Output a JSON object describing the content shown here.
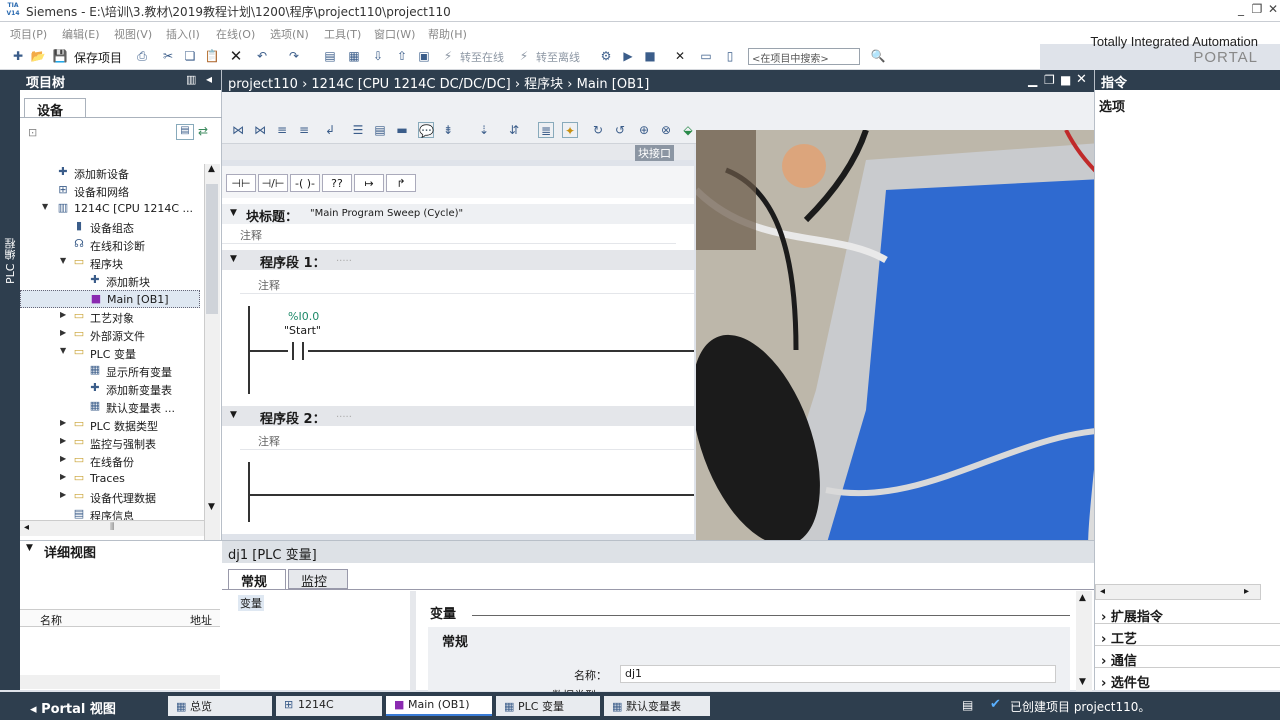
{
  "window": {
    "title": "Siemens  -  E:\\培训\\3.教材\\2019教程计划\\1200\\程序\\project110\\project110",
    "logo": "TIA V14",
    "controls": {
      "minimize": "_",
      "restore": "❐",
      "close": "✕"
    }
  },
  "menu": [
    "项目(P)",
    "编辑(E)",
    "视图(V)",
    "插入(I)",
    "在线(O)",
    "选项(N)",
    "工具(T)",
    "窗口(W)",
    "帮助(H)"
  ],
  "toolbar": {
    "save_label": "保存项目",
    "go_online": "转至在线",
    "go_offline": "转至离线",
    "search_placeholder": "<在项目中搜索>"
  },
  "brand": {
    "line1": "Totally Integrated Automation",
    "line2": "PORTAL"
  },
  "side_tab": {
    "label": "PLC 编程"
  },
  "project_tree": {
    "title": "项目树",
    "tab": "设备",
    "items": [
      {
        "label": "添加新设备",
        "indent": 0
      },
      {
        "label": "设备和网络",
        "indent": 0
      },
      {
        "label": "1214C [CPU 1214C ...",
        "indent": 0
      },
      {
        "label": "设备组态",
        "indent": 1
      },
      {
        "label": "在线和诊断",
        "indent": 1
      },
      {
        "label": "程序块",
        "indent": 1
      },
      {
        "label": "添加新块",
        "indent": 2
      },
      {
        "label": "Main [OB1]",
        "indent": 2
      },
      {
        "label": "工艺对象",
        "indent": 1
      },
      {
        "label": "外部源文件",
        "indent": 1
      },
      {
        "label": "PLC 变量",
        "indent": 1
      },
      {
        "label": "显示所有变量",
        "indent": 2
      },
      {
        "label": "添加新变量表",
        "indent": 2
      },
      {
        "label": "默认变量表 ...",
        "indent": 2
      },
      {
        "label": "PLC 数据类型",
        "indent": 1
      },
      {
        "label": "监控与强制表",
        "indent": 1
      },
      {
        "label": "在线备份",
        "indent": 1
      },
      {
        "label": "Traces",
        "indent": 1
      },
      {
        "label": "设备代理数据",
        "indent": 1
      },
      {
        "label": "程序信息",
        "indent": 1
      }
    ]
  },
  "detail_view": {
    "title": "详细视图",
    "col_name": "名称",
    "col_address": "地址"
  },
  "editor": {
    "breadcrumb": "project110  ›  1214C [CPU 1214C DC/DC/DC]  ›  程序块  ›  Main [OB1]",
    "block_interface": "块接口",
    "block_title_label": "块标题：",
    "block_title_value": "\"Main Program Sweep (Cycle)\"",
    "comment": "注释",
    "network1": "程序段 1：",
    "network2": "程序段 2：",
    "dots": ".....",
    "contact_address": "%I0.0",
    "contact_tag": "\"Start\""
  },
  "ladder_buttons": [
    "⊣⊢",
    "⊣/⊢",
    "-( )-",
    "??",
    "↦",
    "↱"
  ],
  "instructions": {
    "title": "指令",
    "options": "选项",
    "groups": [
      "扩展指令",
      "工艺",
      "通信",
      "选件包"
    ]
  },
  "inspector": {
    "title": "dj1 [PLC 变量]",
    "tab_general": "常规",
    "tab_monitor": "监控",
    "nav_item": "变量",
    "section": "变量",
    "subsection": "常规",
    "name_label": "名称：",
    "name_value": "dj1",
    "datatype_label": "数据类型："
  },
  "taskbar": {
    "portal": "Portal 视图",
    "tasks": [
      "总览",
      "1214C",
      "Main (OB1)",
      "PLC 变量",
      "默认变量表"
    ],
    "status": "已创建项目 project110。"
  }
}
